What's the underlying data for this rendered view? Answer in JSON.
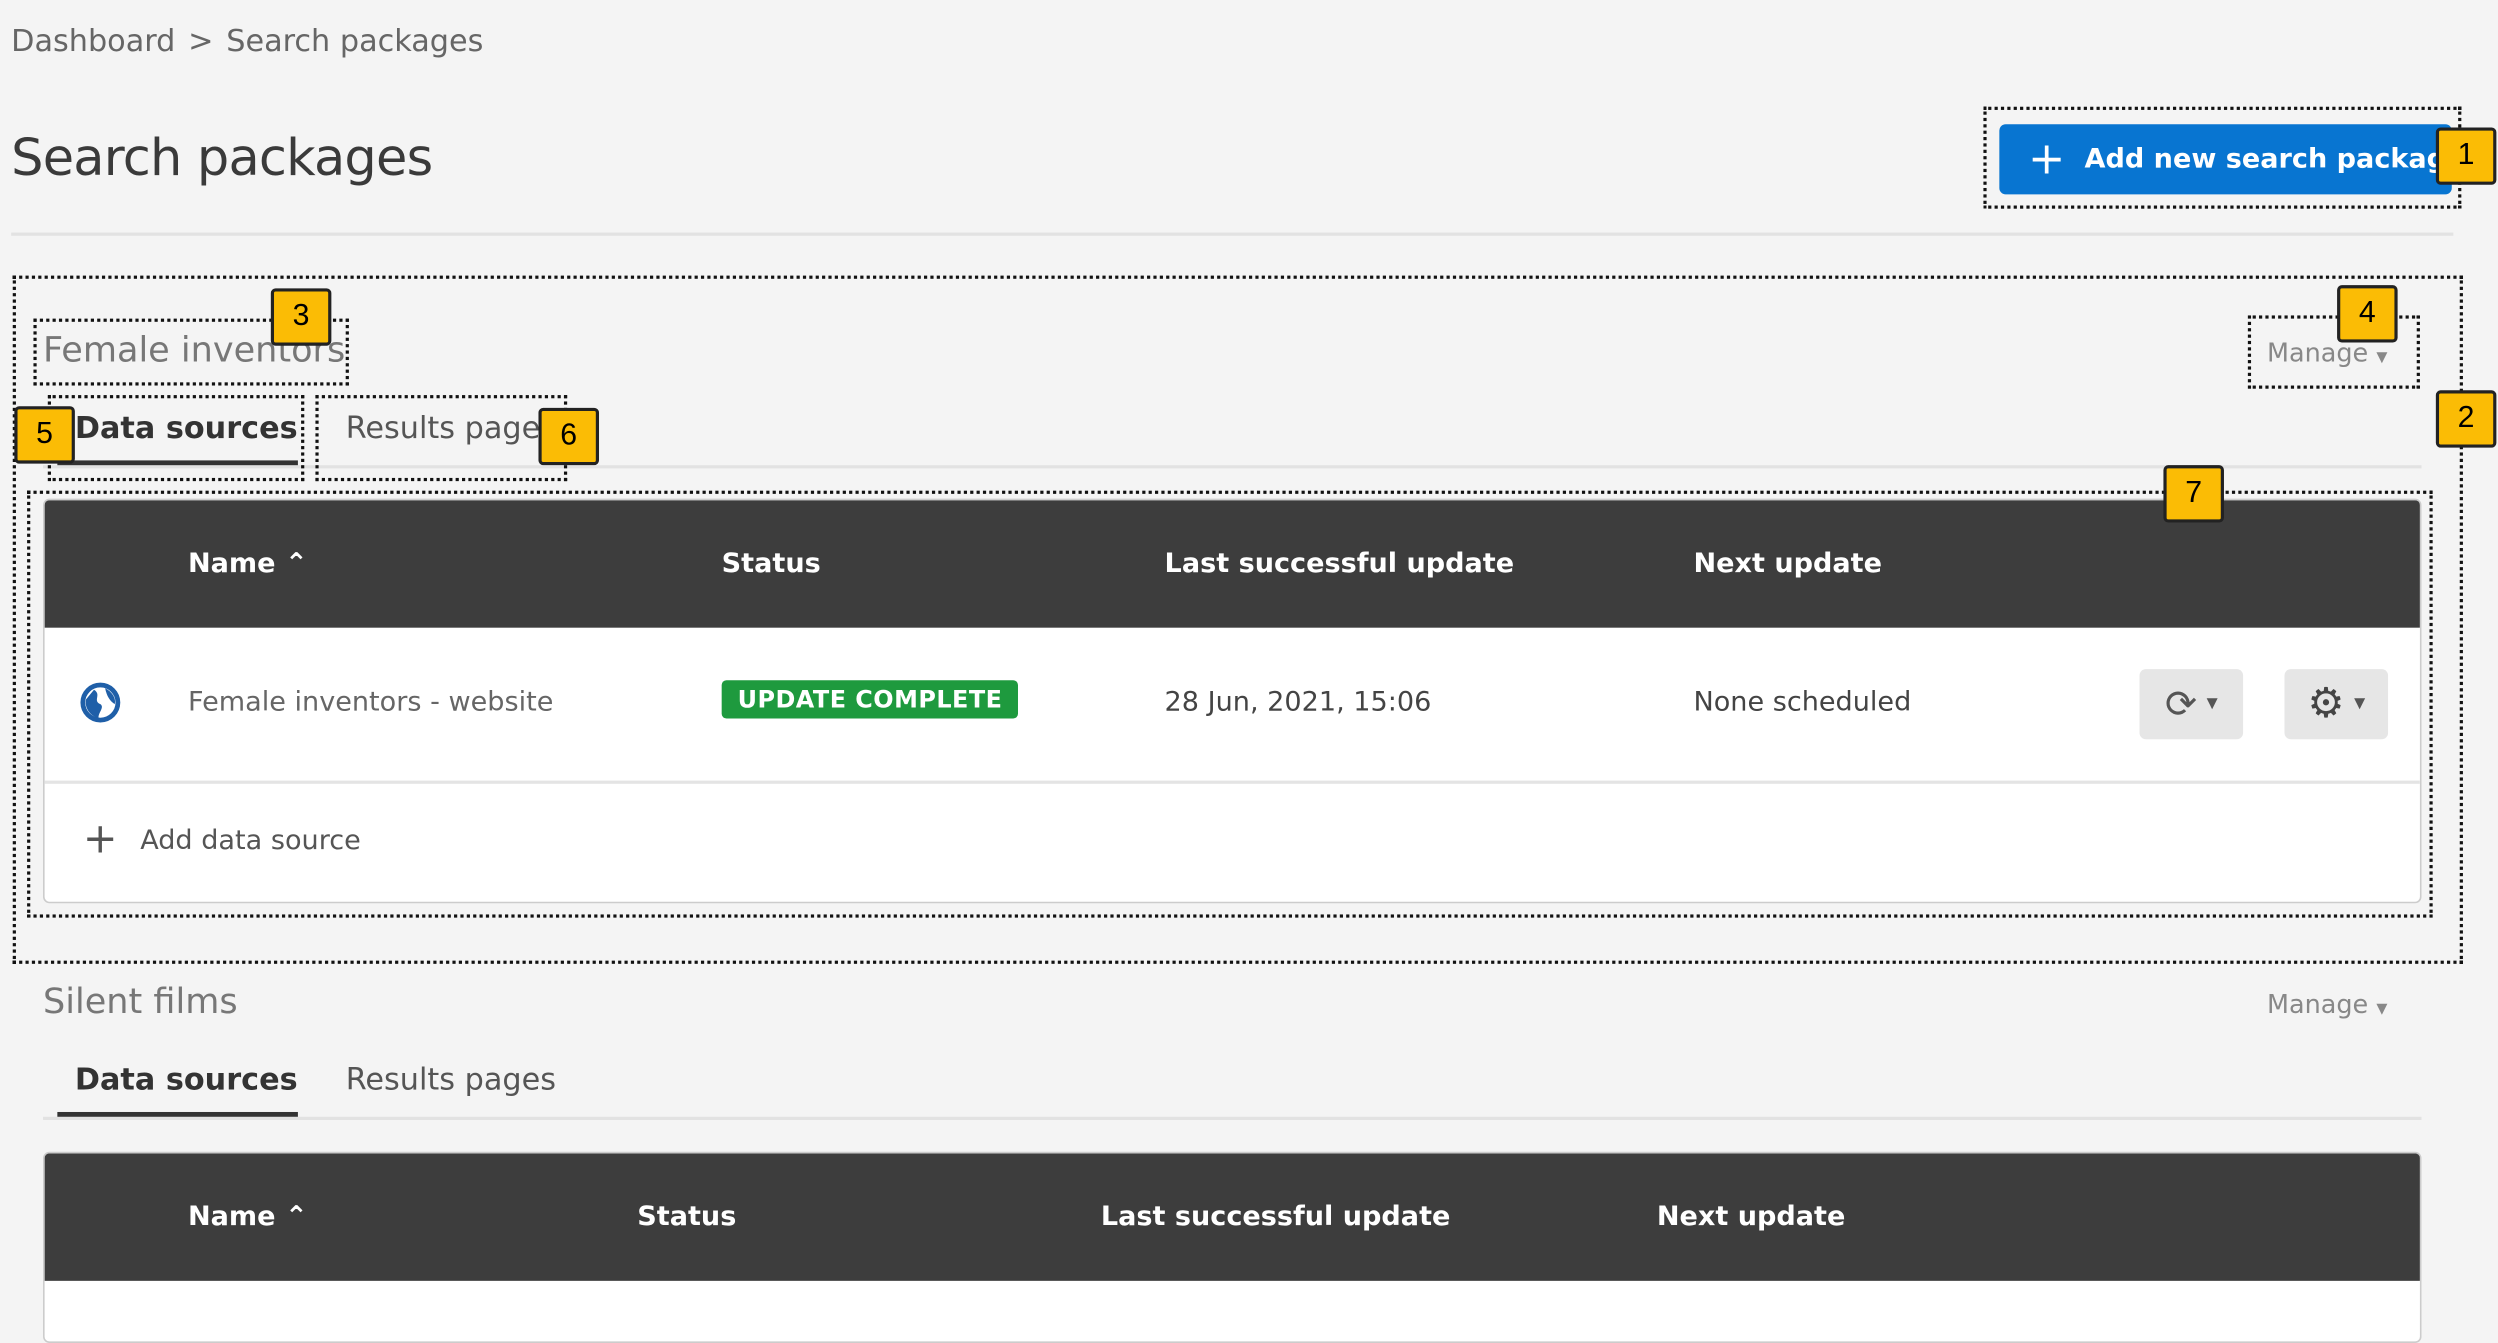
{
  "breadcrumb": {
    "items": [
      "Dashboard",
      "Search packages"
    ],
    "separator": ">"
  },
  "page": {
    "title": "Search packages",
    "add_button": "Add new search package"
  },
  "packages": [
    {
      "name": "Female inventors",
      "manage": "Manage",
      "tabs": [
        "Data sources",
        "Results pages"
      ],
      "active_tab": "Data sources",
      "table": {
        "headers": [
          "Name",
          "Status",
          "Last successful update",
          "Next update"
        ],
        "rows": [
          {
            "icon": "globe-icon",
            "name": "Female inventors - website",
            "status": "UPDATE COMPLETE",
            "last_update": "28 Jun, 2021, 15:06",
            "next_update": "None scheduled"
          }
        ],
        "add_label": "Add data source"
      }
    },
    {
      "name": "Silent films",
      "manage": "Manage",
      "tabs": [
        "Data sources",
        "Results pages"
      ],
      "active_tab": "Data sources",
      "table": {
        "headers": [
          "Name",
          "Status",
          "Last successful update",
          "Next update"
        ]
      }
    }
  ],
  "annotations": [
    "1",
    "2",
    "3",
    "4",
    "5",
    "6",
    "7"
  ],
  "colors": {
    "primary": "#0875d1",
    "success": "#1e9a3e",
    "header": "#3d3d3d",
    "annotation": "#fbbc05"
  }
}
